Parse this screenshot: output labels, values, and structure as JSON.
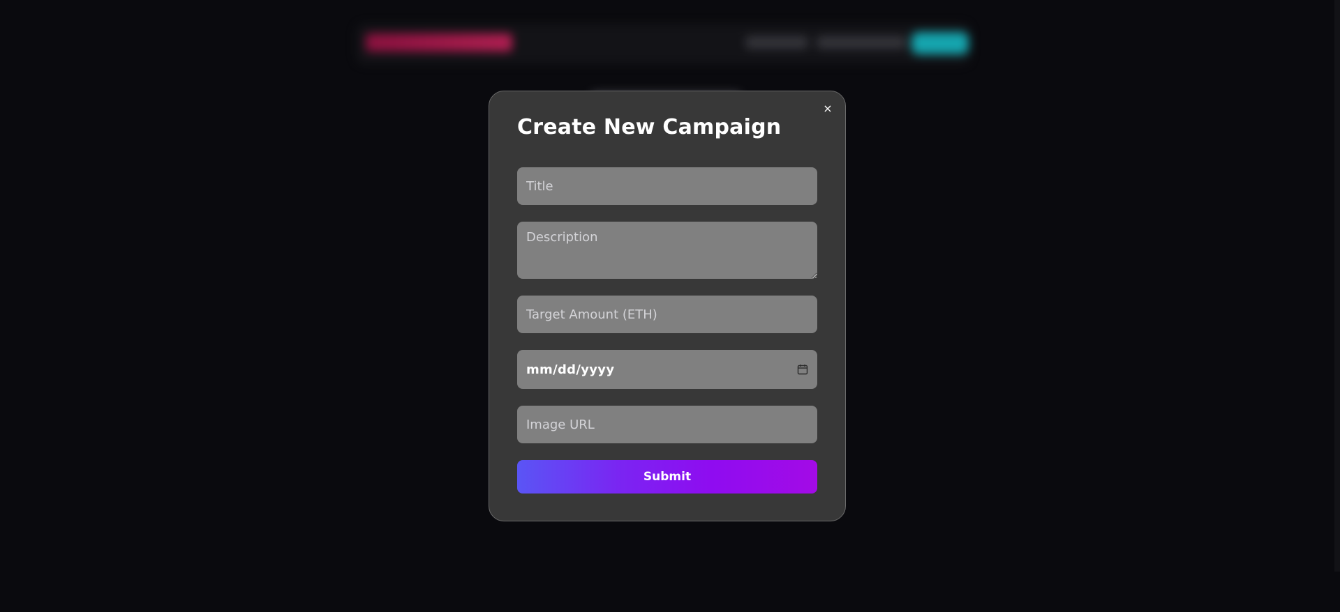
{
  "modal": {
    "title": "Create New Campaign",
    "close_label": "×",
    "fields": {
      "title_placeholder": "Title",
      "description_placeholder": "Description",
      "target_placeholder": "Target Amount (ETH)",
      "date_placeholder": "mm/dd/yyyy",
      "image_placeholder": "Image URL"
    },
    "submit_label": "Submit"
  },
  "icons": {
    "close": "close-icon",
    "calendar": "calendar-icon"
  },
  "colors": {
    "page_background": "#0a0a0e",
    "modal_background": "#383838",
    "input_background": "#808080",
    "submit_gradient_start": "#5a55f5",
    "submit_gradient_end": "#a30be6",
    "background_logo_accent": "#e02464",
    "background_cta_accent": "#17b6c0"
  }
}
